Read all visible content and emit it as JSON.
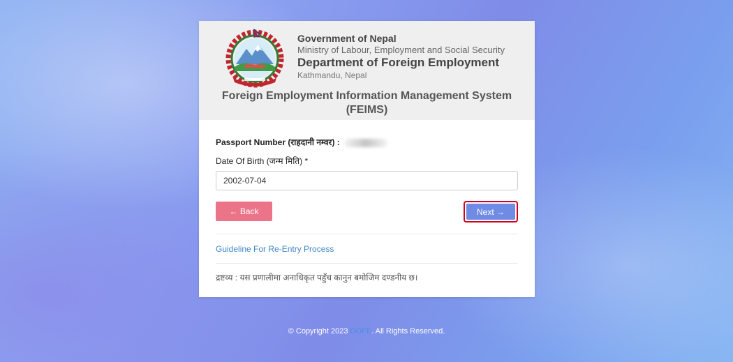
{
  "header": {
    "gov_title": "Government of Nepal",
    "ministry": "Ministry of Labour, Employment and Social Security",
    "department": "Department of Foreign Employment",
    "city": "Kathmandu, Nepal",
    "system_title_line1": "Foreign Employment Information Management System",
    "system_title_line2": "(FEIMS)"
  },
  "form": {
    "passport_label": "Passport Number (राहदानी नम्वर) :",
    "dob_label": "Date Of Birth (जन्म मिति) *",
    "dob_value": "2002-07-04",
    "back_label": "← Back",
    "next_label": "Next →"
  },
  "links": {
    "guideline": "Guideline For Re-Entry Process"
  },
  "note": "द्रष्टव्य : यस प्रणालीमा अनाधिकृत पहुँच कानुन बमोजिम दण्डनीय छ।",
  "footer": {
    "prefix": "© Copyright 2023 ",
    "brand": "DOFE",
    "suffix": ". All Rights Reserved."
  },
  "colors": {
    "back_button": "#ec7489",
    "next_button": "#6f8be3",
    "highlight_border": "#d0021b",
    "link": "#3e86c6"
  }
}
